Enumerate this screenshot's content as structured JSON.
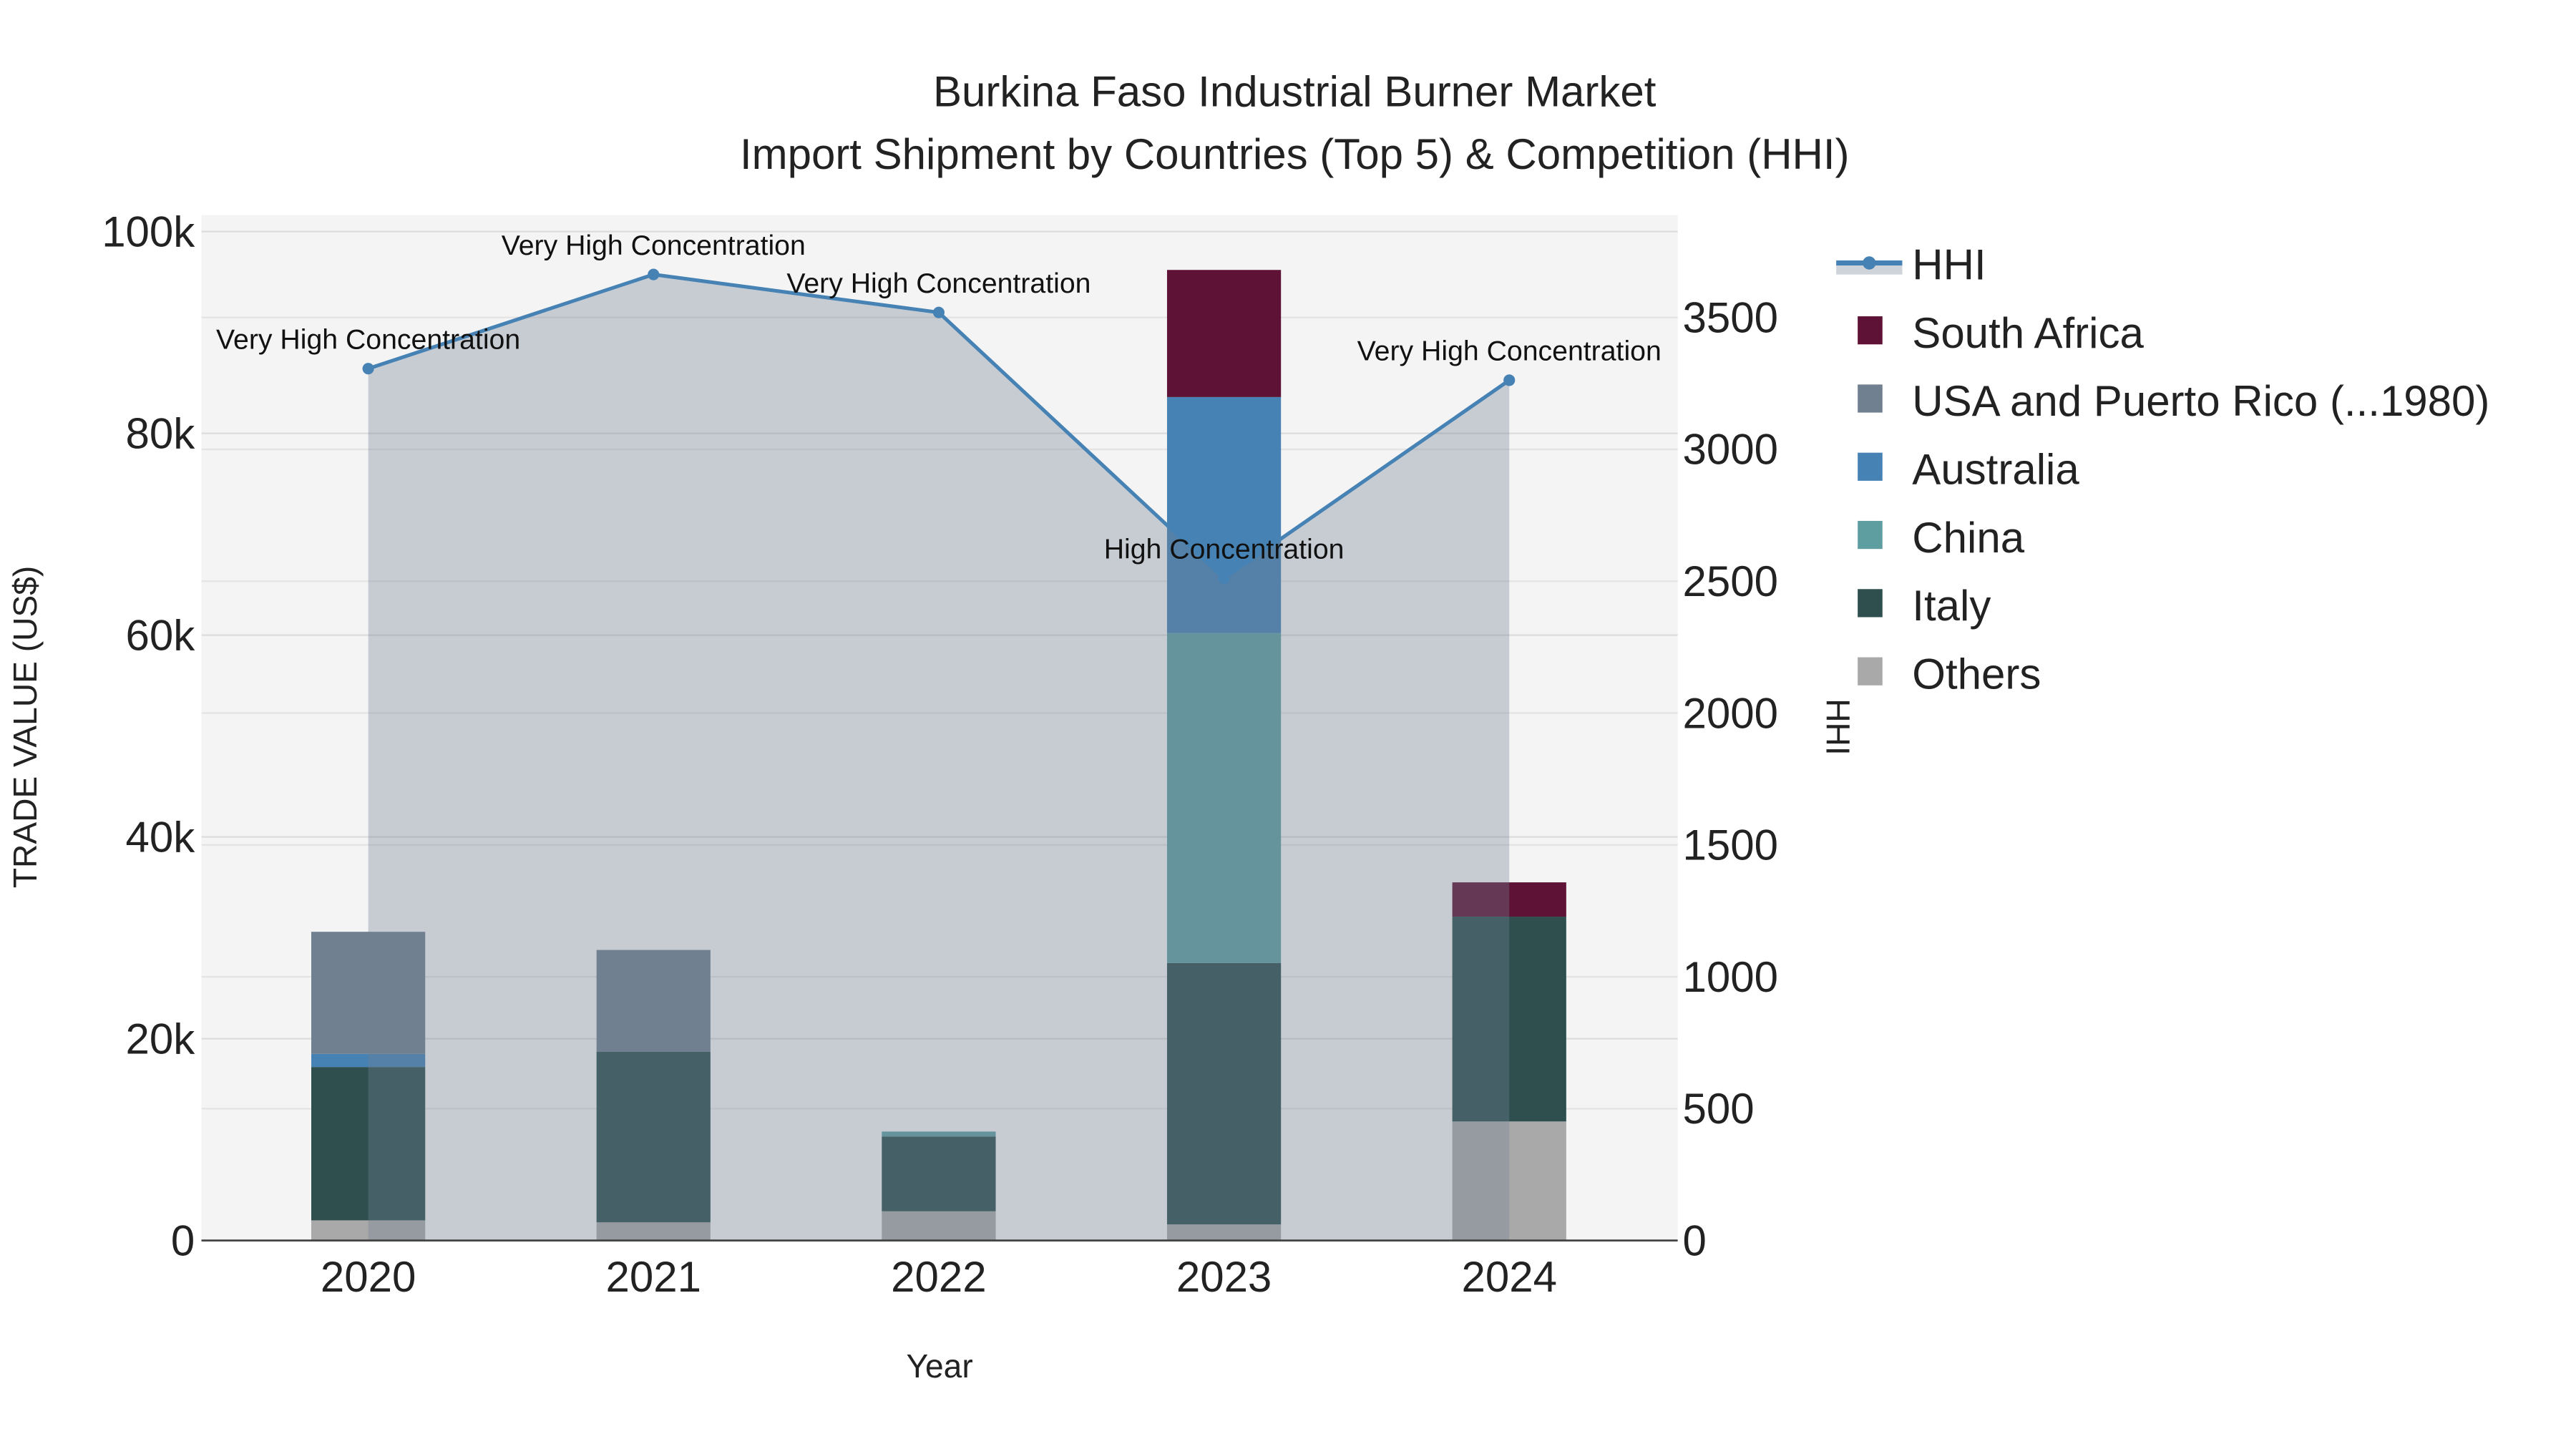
{
  "chart_data": {
    "type": "bar",
    "title_line1": "Burkina Faso Industrial Burner Market",
    "title_line2": "Import Shipment by Countries (Top 5) & Competition (HHI)",
    "xlabel": "Year",
    "ylabel": "TRADE VALUE (US$)",
    "y2label": "HHI",
    "categories": [
      "2020",
      "2021",
      "2022",
      "2023",
      "2024"
    ],
    "ylim": [
      0,
      100000
    ],
    "y2lim": [
      0,
      3800
    ],
    "yticks": [
      0,
      20000,
      40000,
      60000,
      80000,
      100000
    ],
    "ytick_labels": [
      "0",
      "20k",
      "40k",
      "60k",
      "80k",
      "100k"
    ],
    "y2ticks": [
      0,
      500,
      1000,
      1500,
      2000,
      2500,
      3000,
      3500
    ],
    "y2tick_labels": [
      "0",
      "500",
      "1000",
      "1500",
      "2000",
      "2500",
      "3000",
      "3500"
    ],
    "grid": true,
    "legend_position": "right",
    "series": [
      {
        "name": "Others",
        "color": "#a9a9a9",
        "values": [
          2000,
          1800,
          2900,
          1600,
          11800
        ]
      },
      {
        "name": "Italy",
        "color": "#2f4f4f",
        "values": [
          15200,
          16900,
          7400,
          25900,
          20300
        ]
      },
      {
        "name": "China",
        "color": "#5f9ea0",
        "values": [
          0,
          0,
          500,
          32700,
          0
        ]
      },
      {
        "name": "Australia",
        "color": "#4682b4",
        "values": [
          1300,
          0,
          0,
          23400,
          0
        ]
      },
      {
        "name": "USA and Puerto Rico (...1980)",
        "color": "#708090",
        "values": [
          12100,
          10100,
          0,
          0,
          0
        ]
      },
      {
        "name": "South Africa",
        "color": "#5e1235",
        "values": [
          0,
          0,
          0,
          12600,
          3400
        ]
      }
    ],
    "hhi": {
      "name": "HHI",
      "color": "#4682b4",
      "values": [
        3306,
        3663,
        3519,
        2511,
        3262
      ],
      "annotations": [
        "Very High Concentration",
        "Very High Concentration",
        "Very High Concentration",
        "High Concentration",
        "Very High Concentration"
      ]
    },
    "legend_order": [
      "HHI",
      "South Africa",
      "USA and Puerto Rico (...1980)",
      "Australia",
      "China",
      "Italy",
      "Others"
    ]
  }
}
